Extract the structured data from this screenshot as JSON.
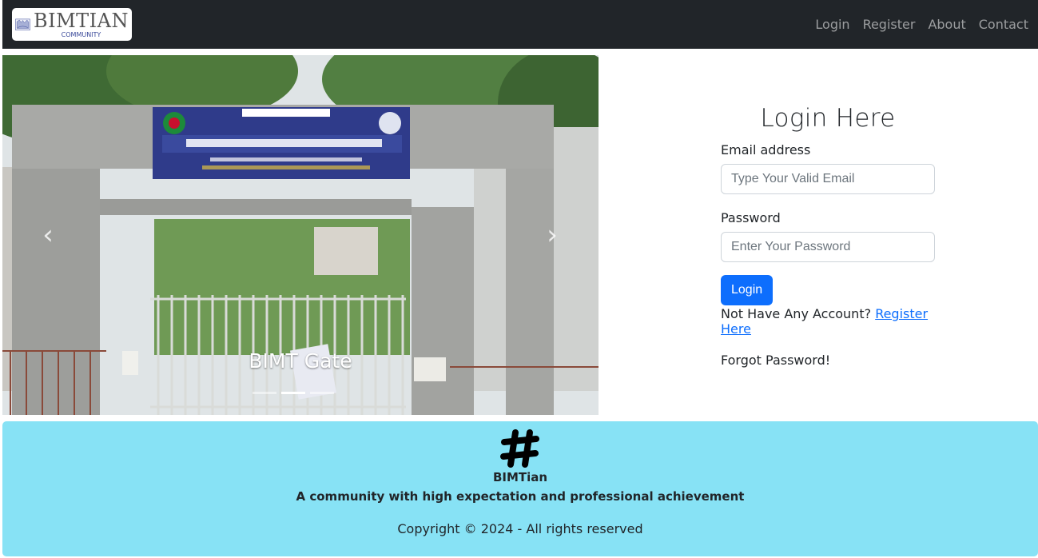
{
  "nav": {
    "brand_title": "BIMTIAN",
    "brand_subtitle": "COMMUNITY",
    "links": [
      "Login",
      "Register",
      "About",
      "Contact"
    ]
  },
  "carousel": {
    "caption": "BIMT Gate",
    "slide_count": 3,
    "active_slide": 2
  },
  "login": {
    "title": "Login Here",
    "email_label": "Email address",
    "email_placeholder": "Type Your Valid Email",
    "password_label": "Password",
    "password_placeholder": "Enter Your Password",
    "submit_label": "Login",
    "no_account_text": "Not Have Any Account?",
    "register_link": "Register Here",
    "forgot_text": "Forgot Password!"
  },
  "footer": {
    "icon": "hashtag-icon",
    "name": "BIMTian",
    "tagline": "A community with high expectation and professional achievement",
    "copyright": "Copyright © 2024 - All rights reserved"
  },
  "colors": {
    "navbar_bg": "#212529",
    "primary": "#0d6efd",
    "footer_bg": "#87e2f5"
  }
}
